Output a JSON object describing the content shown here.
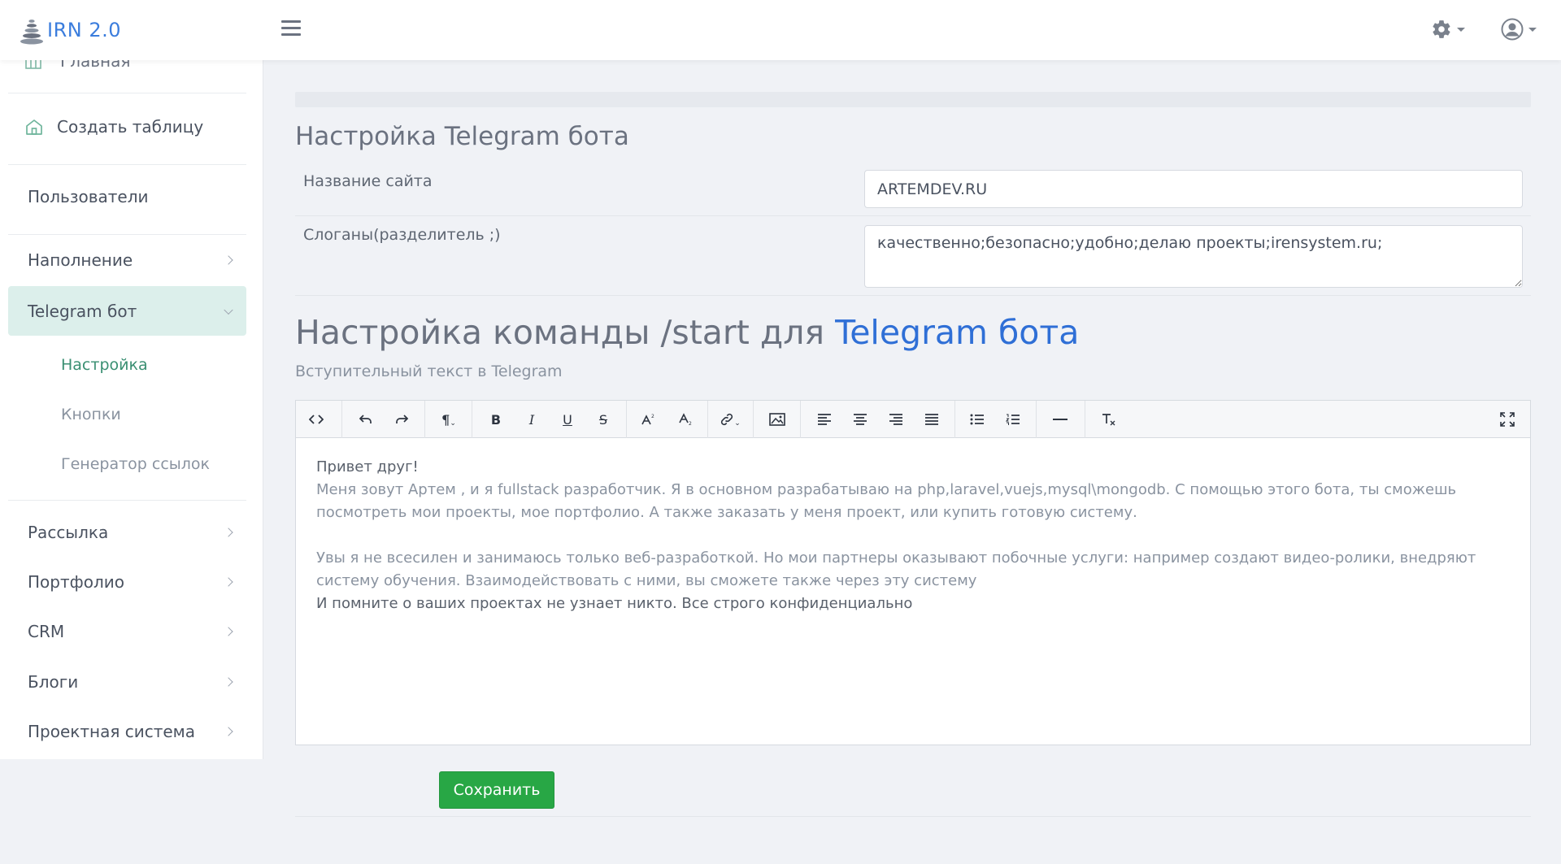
{
  "header": {
    "brand": "IRN 2.0",
    "icons": {
      "logo": "stacked-stones-icon",
      "menu": "hamburger-icon",
      "settings": "gear-icon",
      "user": "user-circle-icon"
    }
  },
  "sidebar": {
    "partial_top": "Главная",
    "items": [
      {
        "label": "Создать таблицу",
        "icon": "home-icon"
      },
      {
        "label": "Пользователи"
      },
      {
        "label": "Наполнение"
      },
      {
        "label": "Telegram бот"
      },
      {
        "label": "Рассылка"
      },
      {
        "label": "Портфолио"
      },
      {
        "label": "CRM"
      },
      {
        "label": "Блоги"
      },
      {
        "label": "Проектная система"
      }
    ],
    "sub_items": [
      "Настройка",
      "Кнопки",
      "Генератор ссылок"
    ]
  },
  "main": {
    "settings_title": "Настройка Telegram бота",
    "site_name_label": "Название сайта",
    "site_name_value": "ARTEMDEV.RU",
    "slogans_label": "Слоганы(разделитель ;)",
    "slogans_value": "качественно;безопасно;удобно;делаю проекты;irensystem.ru;",
    "start_title_prefix": "Настройка команды /start для",
    "start_title_accent": "Telegram бота",
    "intro_label": "Вступительный текст в Telegram",
    "editor": {
      "line1": "Привет друг!",
      "para1": "Меня зовут Артем , и я fullstack разработчик. Я в основном разрабатываю на php,laravel,vuejs,mysql\\mongodb. С помощью этого бота, ты сможешь посмотреть мои проекты, мое портфолио. А также заказать у меня проект, или купить готовую систему.",
      "para2": "Увы я не всесилен и занимаюсь только веб-разработкой. Но мои партнеры оказывают побочные услуги: например создают видео-ролики, внедряют систему обучения. Взаимодействовать с ними, вы сможете также через эту систему",
      "line_last": "И помните о ваших проектах не узнает никто. Все строго конфиденциально"
    },
    "toolbar": {
      "paragraph": "¶",
      "bold": "B",
      "italic": "I",
      "underline": "U",
      "strike": "S"
    },
    "save_label": "Сохранить"
  }
}
